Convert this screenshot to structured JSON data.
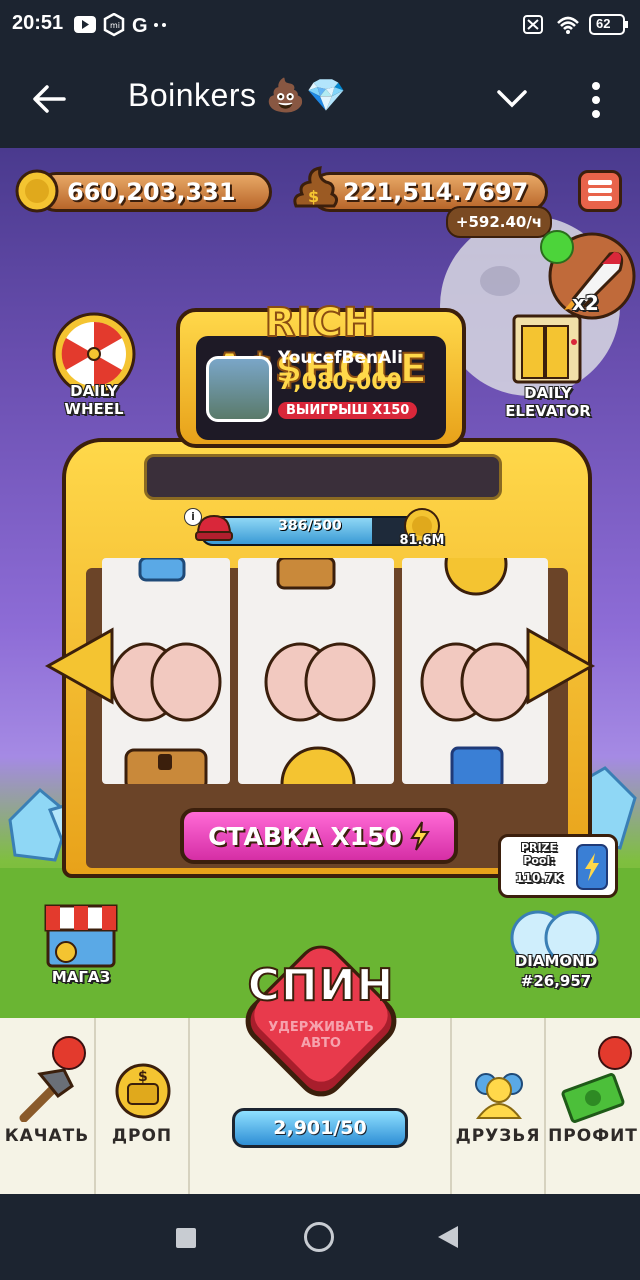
{
  "status_bar": {
    "time": "20:51",
    "battery": "62",
    "carrier_icons": [
      "youtube-icon",
      "mi-icon",
      "google-icon"
    ]
  },
  "app_bar": {
    "title": "Boinkers 💩💎"
  },
  "game": {
    "coins": "660,203,331",
    "poop": "221,514.7697",
    "rate": "+592.40/ч",
    "booster_multiplier": "x2",
    "daily_wheel": "DAILY\nWHEEL",
    "daily_elevator": "DAILY\nELEVATOR",
    "machine_title": "RICH A$$HOLE",
    "winner": {
      "name": "YoucefBenAli",
      "amount": "7,080,000",
      "badge": "ВЫИГРЫШ X150"
    },
    "progress": {
      "text": "386/500",
      "value": 0.772,
      "reward": "81.6M",
      "info": "i"
    },
    "bet_button": "СТАВКА X150",
    "prize_pool": {
      "label": "PRIZE\nPool:",
      "value": "110.7K"
    },
    "diamond": {
      "name": "DIAMOND",
      "id": "#26,957"
    },
    "shop": "МАГАЗ",
    "spin": {
      "label": "СПИН",
      "hint": "УДЕРЖИВАТЬ\nАВТО",
      "counter": "2,901/50"
    }
  },
  "bottom_nav": {
    "upgrade": "КАЧАТЬ",
    "drop": "ДРОП",
    "friends": "ДРУЗЬЯ",
    "profit": "ПРОФИТ"
  },
  "colors": {
    "bg_dark": "#1c2430",
    "gold": "#f4c431",
    "pink": "#e83fb7",
    "red": "#d9273a",
    "nav_bg": "#f5f3e6"
  }
}
